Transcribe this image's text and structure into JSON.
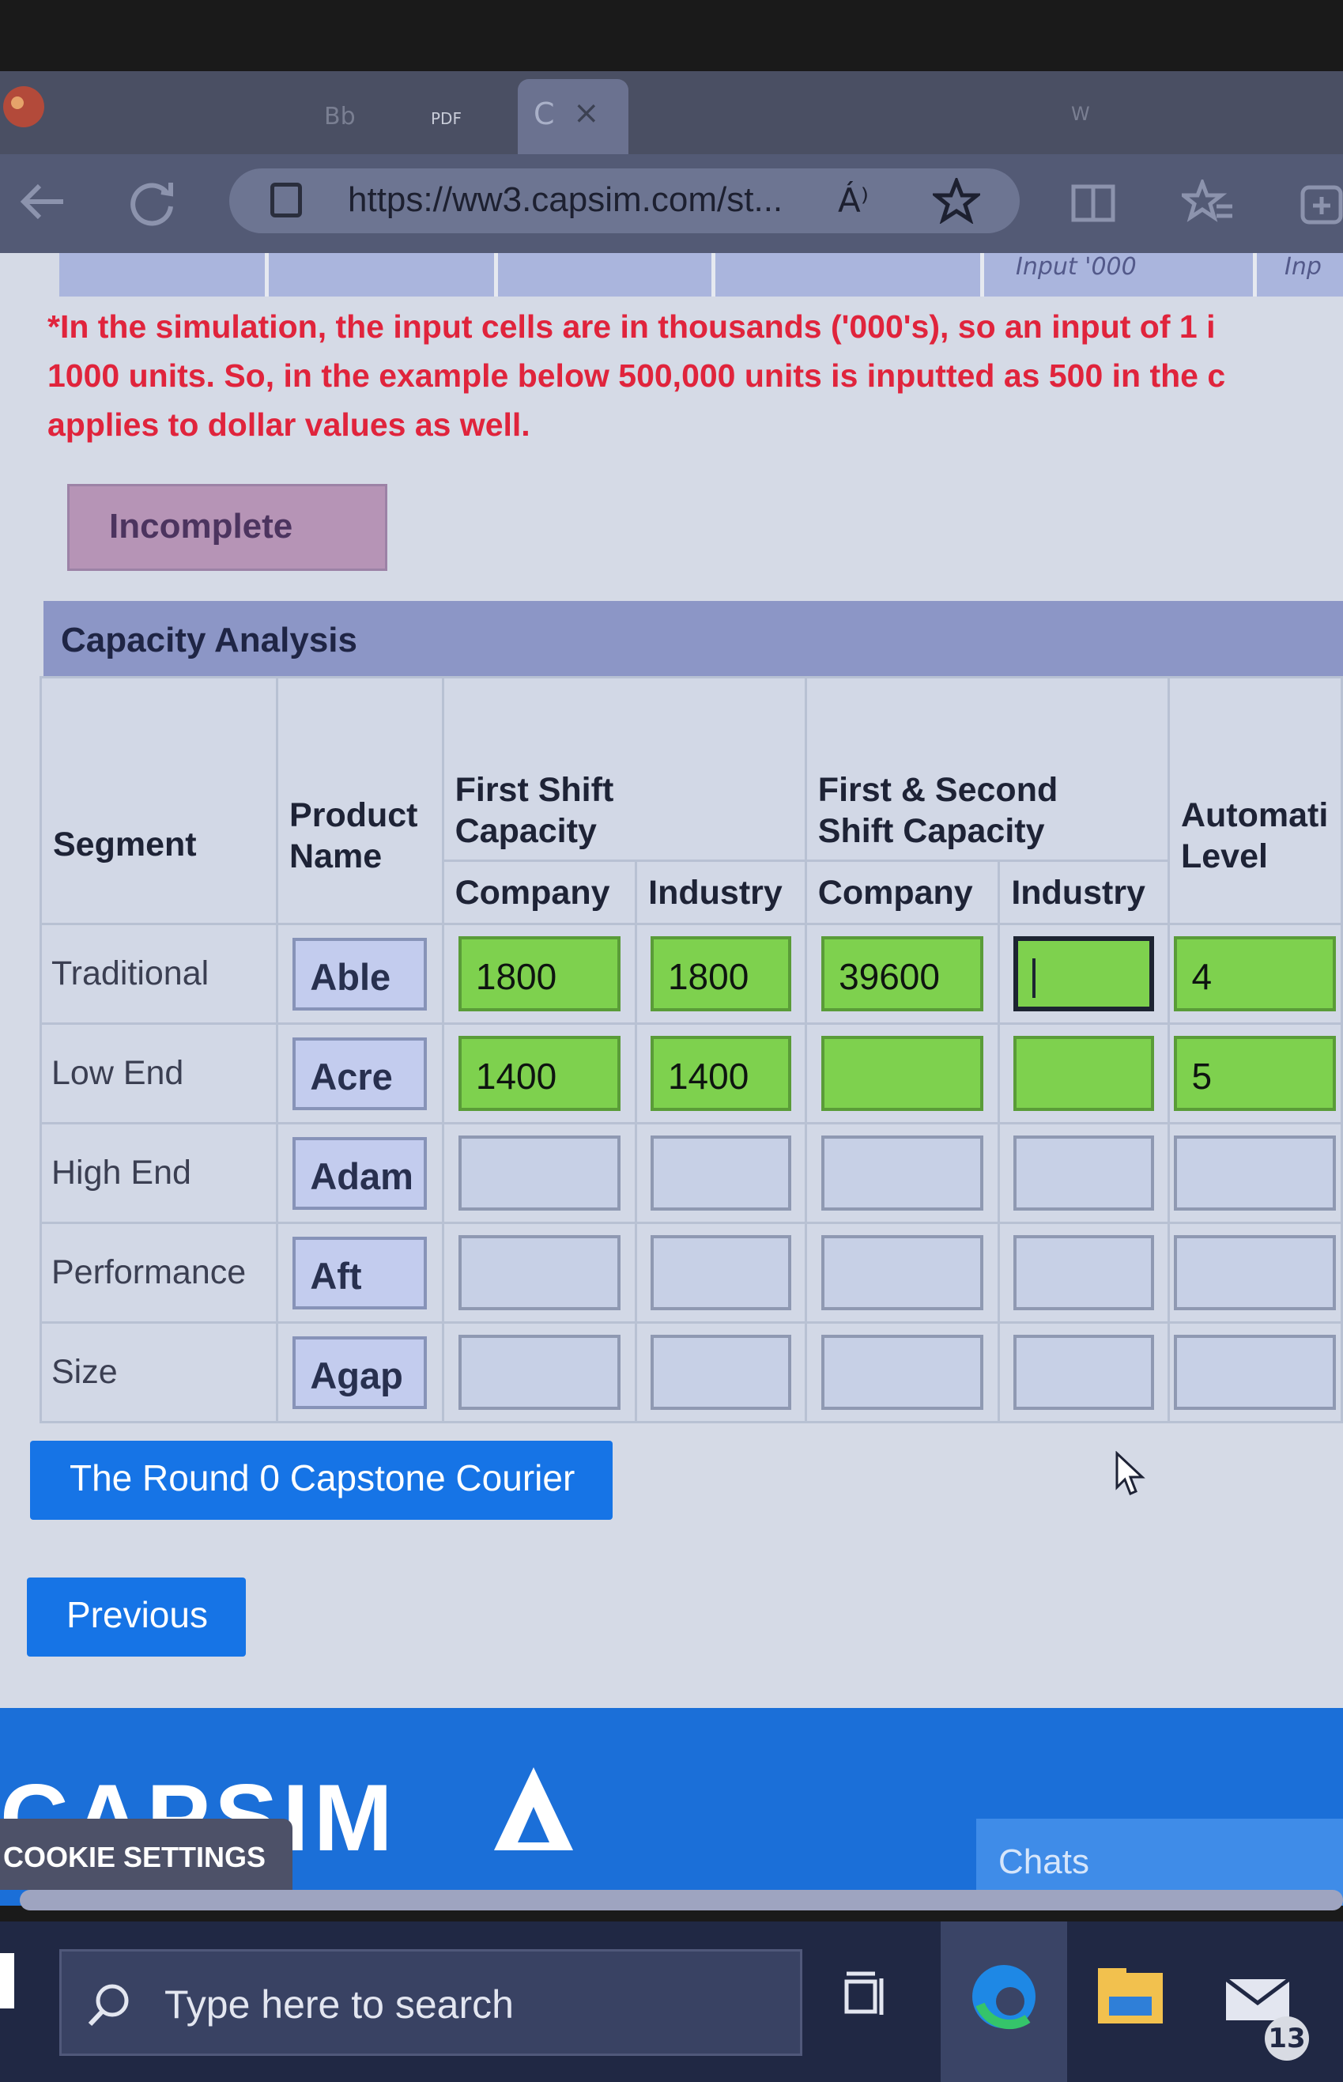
{
  "browser": {
    "tab_ghost_labels": [
      "Bb",
      "PDF",
      "W"
    ],
    "active_tab_label": "C",
    "active_tab_close": "×",
    "url": "https://ww3.capsim.com/st...",
    "read_aloud_label": "Á⁾",
    "icons": [
      "back-icon",
      "refresh-icon",
      "lock-icon",
      "read-aloud-icon",
      "favorite-star-icon",
      "split-screen-icon",
      "favorites-icon",
      "collections-icon"
    ]
  },
  "page": {
    "top_strip_label_1": "Input '000",
    "top_strip_label_2": "Inp",
    "notice": [
      "*In the simulation, the input cells are in thousands ('000's), so an input of 1 i",
      "1000 units. So, in the example below 500,000 units is inputted as 500 in the c",
      "applies to dollar values as well."
    ],
    "status_button": "Incomplete",
    "panel_title": "Capacity Analysis",
    "table": {
      "headers": {
        "segment": "Segment",
        "product_name": [
          "Product",
          "Name"
        ],
        "first_shift": [
          "First Shift",
          "Capacity"
        ],
        "first_second_shift": [
          "First & Second",
          "Shift Capacity"
        ],
        "automation": [
          "Automati",
          "Level"
        ],
        "company": "Company",
        "industry": "Industry"
      },
      "rows": [
        {
          "segment": "Traditional",
          "product": "Able",
          "fs_company": "1800",
          "fs_industry": "1800",
          "fss_company": "39600",
          "fss_industry": "",
          "automation": "4"
        },
        {
          "segment": "Low End",
          "product": "Acre",
          "fs_company": "1400",
          "fs_industry": "1400",
          "fss_company": "",
          "fss_industry": "",
          "automation": "5"
        },
        {
          "segment": "High End",
          "product": "Adam",
          "fs_company": "",
          "fs_industry": "",
          "fss_company": "",
          "fss_industry": "",
          "automation": ""
        },
        {
          "segment": "Performance",
          "product": "Aft",
          "fs_company": "",
          "fs_industry": "",
          "fss_company": "",
          "fss_industry": "",
          "automation": ""
        },
        {
          "segment": "Size",
          "product": "Agap",
          "fs_company": "",
          "fs_industry": "",
          "fss_company": "",
          "fss_industry": "",
          "automation": ""
        }
      ]
    },
    "courier_button": "The Round 0 Capstone Courier",
    "previous_button": "Previous"
  },
  "footer": {
    "brand": "CAPSIM",
    "cookie_button": "COOKIE SETTINGS",
    "chats_button": "Chats"
  },
  "taskbar": {
    "search_placeholder": "Type here to search",
    "mail_badge": "13"
  },
  "colors": {
    "filled_input": "#7ed14e",
    "empty_input": "#c7d0e6",
    "primary_button": "#1674e6",
    "notice_text": "#e0243c",
    "incomplete_badge": "#b694b6"
  }
}
